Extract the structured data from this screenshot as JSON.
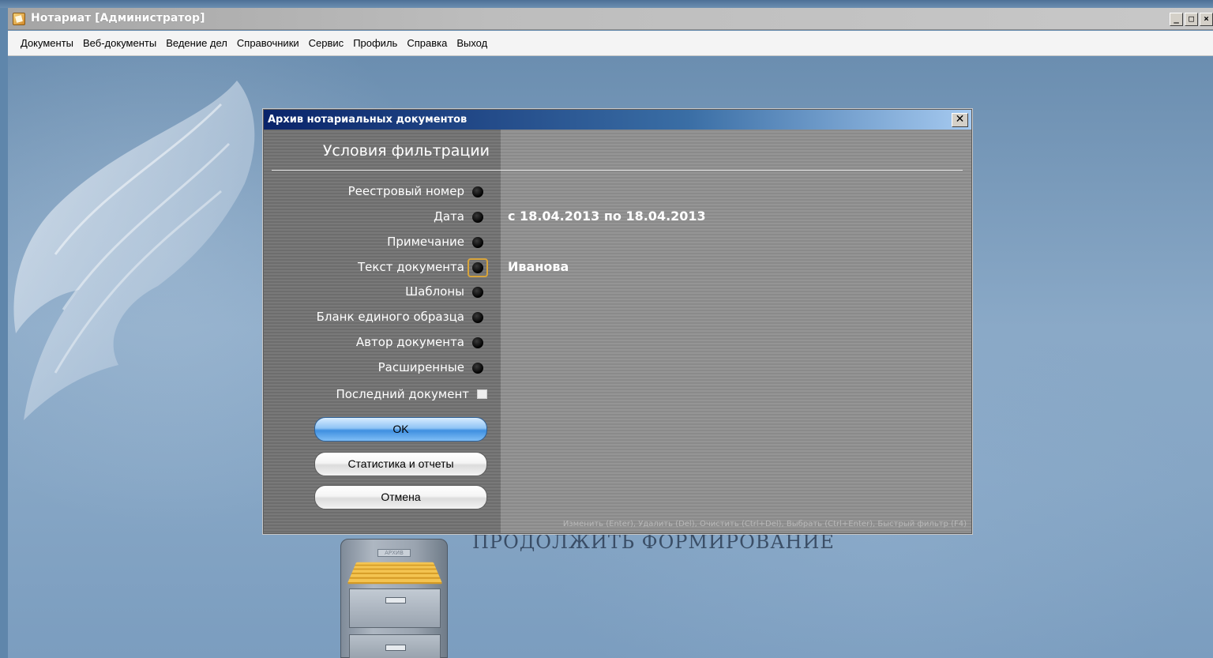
{
  "app": {
    "title": "Нотариат [Администратор]",
    "window_buttons": {
      "minimize": "_",
      "maximize": "□",
      "close": "×"
    }
  },
  "menu": {
    "items": [
      {
        "label": "Документы"
      },
      {
        "label": "Веб-документы"
      },
      {
        "label": "Ведение дел"
      },
      {
        "label": "Справочники"
      },
      {
        "label": "Сервис"
      },
      {
        "label": "Профиль"
      },
      {
        "label": "Справка"
      },
      {
        "label": "Выход"
      }
    ]
  },
  "background": {
    "caption": "ПРОДОЛЖИТЬ ФОРМИРОВАНИЕ",
    "cabinet_label": "АРХИВ"
  },
  "dialog": {
    "title": "Архив нотариальных документов",
    "close_glyph": "✕",
    "heading": "Условия фильтрации",
    "fields": [
      {
        "label": "Реестровый номер",
        "value": ""
      },
      {
        "label": "Дата",
        "value": "с 18.04.2013 по 18.04.2013"
      },
      {
        "label": "Примечание",
        "value": ""
      },
      {
        "label": "Текст документа",
        "value": "Иванова",
        "focused": true
      },
      {
        "label": "Шаблоны",
        "value": ""
      },
      {
        "label": "Бланк единого образца",
        "value": ""
      },
      {
        "label": "Автор документа",
        "value": ""
      },
      {
        "label": "Расширенные",
        "value": ""
      }
    ],
    "last_document": {
      "label": "Последний документ",
      "checked": false
    },
    "buttons": {
      "ok": "OK",
      "stats": "Статистика и отчеты",
      "cancel": "Отмена"
    },
    "hint": "Изменить (Enter), Удалить (Del), Очистить (Ctrl+Del), Выбрать (Ctrl+Enter), Быстрый фильтр (F4)"
  },
  "colors": {
    "dialog_title_start": "#0a246a",
    "focus_border": "#d8a43a",
    "ok_button": "#3e8fe0"
  }
}
